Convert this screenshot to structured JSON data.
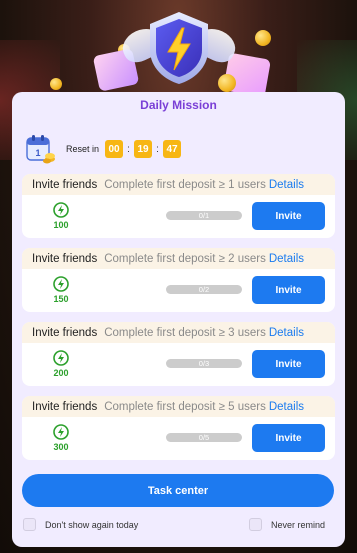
{
  "header": {
    "title": "Daily Mission",
    "reset_label": "Reset in",
    "timer": {
      "hours": "00",
      "minutes": "19",
      "seconds": "47",
      "separator": ":"
    }
  },
  "tasks": [
    {
      "name": "Invite friends",
      "condition": "Complete first deposit ≥ 1 users",
      "details_label": "Details",
      "reward": "100",
      "progress_text": "0/1",
      "progress": 0,
      "button_label": "Invite"
    },
    {
      "name": "Invite friends",
      "condition": "Complete first deposit ≥ 2 users",
      "details_label": "Details",
      "reward": "150",
      "progress_text": "0/2",
      "progress": 0,
      "button_label": "Invite"
    },
    {
      "name": "Invite friends",
      "condition": "Complete first deposit ≥ 3 users",
      "details_label": "Details",
      "reward": "200",
      "progress_text": "0/3",
      "progress": 0,
      "button_label": "Invite"
    },
    {
      "name": "Invite friends",
      "condition": "Complete first deposit ≥ 5 users",
      "details_label": "Details",
      "reward": "300",
      "progress_text": "0/5",
      "progress": 0,
      "button_label": "Invite"
    }
  ],
  "footer": {
    "task_center_label": "Task center",
    "dont_show_label": "Don't show again today",
    "never_remind_label": "Never remind"
  },
  "colors": {
    "accent_blue": "#1d7af0",
    "title_purple": "#7a3fd6",
    "timer_yellow": "#f7b614",
    "reward_green": "#2ca02c",
    "panel_bg": "#f1ecff"
  },
  "icons": {
    "badge": "lightning-shield-icon",
    "calendar": "calendar-icon",
    "reward": "lightning-coin-icon"
  }
}
